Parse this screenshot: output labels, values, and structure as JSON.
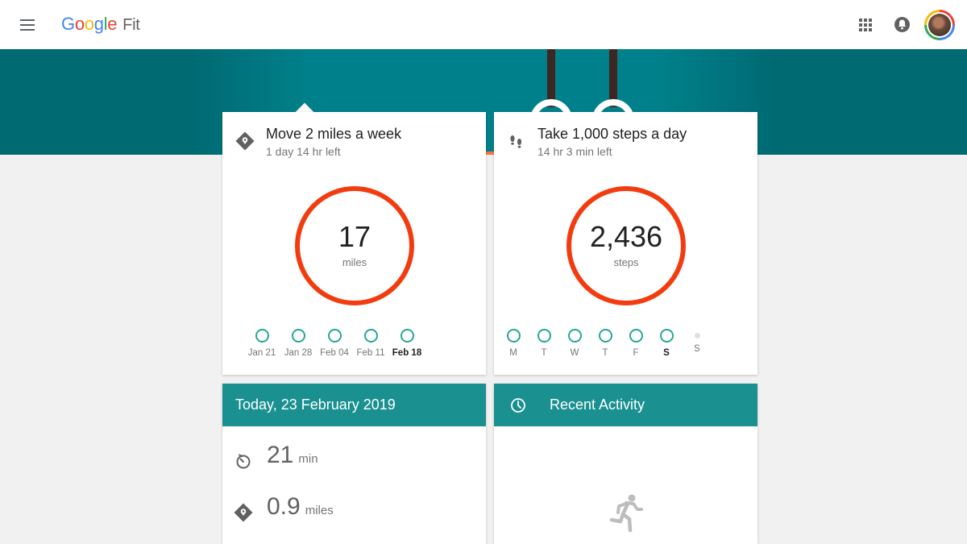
{
  "app": {
    "logo_letters": [
      "G",
      "o",
      "o",
      "g",
      "l",
      "e"
    ],
    "product": "Fit",
    "icons": {
      "menu": "hamburger-menu-icon",
      "apps": "apps-grid-icon",
      "notifications": "bell-icon",
      "account": "avatar"
    }
  },
  "colors": {
    "banner_dark": "#006a73",
    "banner_light": "#00808a",
    "ring": "#f23c0f",
    "history_dot": "#26a69a",
    "section_header": "#1a9090",
    "rope": "#3e2723"
  },
  "goals": [
    {
      "icon": "distance-pin-icon",
      "title": "Move 2 miles a week",
      "time_left": "1 day 14 hr left",
      "value": "17",
      "unit": "miles",
      "history": [
        {
          "label": "Jan 21",
          "state": "complete",
          "current": false
        },
        {
          "label": "Jan 28",
          "state": "complete",
          "current": false
        },
        {
          "label": "Feb 04",
          "state": "complete",
          "current": false
        },
        {
          "label": "Feb 11",
          "state": "complete",
          "current": false
        },
        {
          "label": "Feb 18",
          "state": "complete",
          "current": true
        }
      ]
    },
    {
      "icon": "footsteps-icon",
      "title": "Take 1,000 steps a day",
      "time_left": "14 hr 3 min left",
      "value": "2,436",
      "unit": "steps",
      "history": [
        {
          "label": "M",
          "state": "complete",
          "current": false
        },
        {
          "label": "T",
          "state": "complete",
          "current": false
        },
        {
          "label": "W",
          "state": "complete",
          "current": false
        },
        {
          "label": "T",
          "state": "complete",
          "current": false
        },
        {
          "label": "F",
          "state": "complete",
          "current": false
        },
        {
          "label": "S",
          "state": "complete",
          "current": true
        },
        {
          "label": "S",
          "state": "future",
          "current": false
        }
      ]
    }
  ],
  "today": {
    "title": "Today, 23 February 2019",
    "stats": [
      {
        "icon": "timer-icon",
        "value": "21",
        "unit": "min"
      },
      {
        "icon": "distance-pin-icon",
        "value": "0.9",
        "unit": "miles"
      }
    ]
  },
  "recent": {
    "title": "Recent Activity",
    "icon": "clock-icon",
    "empty_icon": "running-person-icon"
  }
}
